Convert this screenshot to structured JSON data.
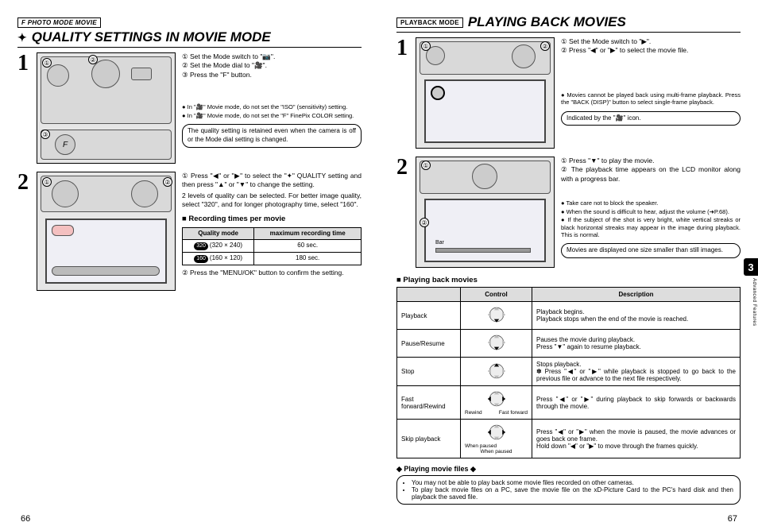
{
  "left": {
    "badge": "F PHOTO MODE MOVIE",
    "title_icon": "✦",
    "title": "QUALITY SETTINGS IN MOVIE MODE",
    "step1": {
      "lines": [
        "① Set the Mode switch to \"📷\".",
        "② Set the Mode dial to \"🎥\".",
        "③ Press the \"F\" button."
      ],
      "notes": [
        "● In \"🎥\" Movie mode, do not set the \"ISO\" (sensitivity) setting.",
        "● In \"🎥\" Movie mode, do not set the \"F\" FinePix COLOR setting."
      ],
      "boxnote": "The quality setting is retained even when the camera is off or the Mode dial setting is changed."
    },
    "step2": {
      "lines": [
        "① Press \"◀\" or \"▶\" to select the \"✦\" QUALITY setting and then press \"▲\" or \"▼\" to change the setting.",
        "2 levels of quality can be selected. For better image quality, select \"320\", and for longer photography time, select \"160\"."
      ],
      "table_title": "Recording times per movie",
      "table_headers": [
        "Quality mode",
        "maximum recording time"
      ],
      "table_rows": [
        {
          "mode_badge": "320",
          "mode": "(320 × 240)",
          "time": "60 sec."
        },
        {
          "mode_badge": "160",
          "mode": "(160 × 120)",
          "time": "180 sec."
        }
      ],
      "after_table": "② Press the \"MENU/OK\" button to confirm the setting."
    },
    "pagenum": "66"
  },
  "right": {
    "badge": "PLAYBACK MODE",
    "title": "PLAYING BACK MOVIES",
    "step1": {
      "lines": [
        "① Set the Mode switch to \"▶\".",
        "② Press \"◀\" or \"▶\" to select the movie file."
      ],
      "notes": [
        "● Movies cannot be played back using multi-frame playback. Press the \"BACK (DISP)\" button to select single-frame playback."
      ],
      "boxnote": "Indicated by the \"🎥\" icon."
    },
    "step2": {
      "lines": [
        "① Press \"▼\" to play the movie.",
        "② The playback time appears on the LCD monitor along with a progress bar."
      ],
      "notes": [
        "● Take care not to block the speaker.",
        "● When the sound is difficult to hear, adjust the volume (➜P.68).",
        "● If the subject of the shot is very bright, white vertical streaks or black horizontal streaks may appear in the image during playback. This is normal."
      ],
      "boxnote": "Movies are displayed one size smaller than still images."
    },
    "ctrl_title": "Playing back movies",
    "ctrl_headers": [
      "",
      "Control",
      "Description"
    ],
    "ctrl_rows": [
      {
        "name": "Playback",
        "sub": "",
        "desc": "Playback begins.\nPlayback stops when the end of the movie is reached."
      },
      {
        "name": "Pause/Resume",
        "sub": "",
        "desc": "Pauses the movie during playback.\nPress \"▼\" again to resume playback."
      },
      {
        "name": "Stop",
        "sub": "",
        "desc": "Stops playback.\n✽ Press \"◀\" or \"▶\" while playback is stopped to go back to the previous file or advance to the next file respectively."
      },
      {
        "name": "Fast forward/Rewind",
        "sub": "Rewind        Fast forward",
        "desc": "Press \"◀\" or \"▶\" during playback to skip forwards or backwards through the movie."
      },
      {
        "name": "Skip playback",
        "sub": "When paused",
        "desc": "Press \"◀\" or \"▶\" when the movie is paused, the movie advances or goes back one frame.\nHold down \"◀\" or \"▶\" to move through the frames quickly."
      }
    ],
    "files_title": "◆ Playing movie files ◆",
    "files": [
      "You may not be able to play back some movie files recorded on other cameras.",
      "To play back movie files on a PC, save the movie file on the xD-Picture Card to the PC's hard disk and then playback the saved file."
    ],
    "chapter_num": "3",
    "chapter_label": "Advanced Features",
    "pagenum": "67"
  }
}
